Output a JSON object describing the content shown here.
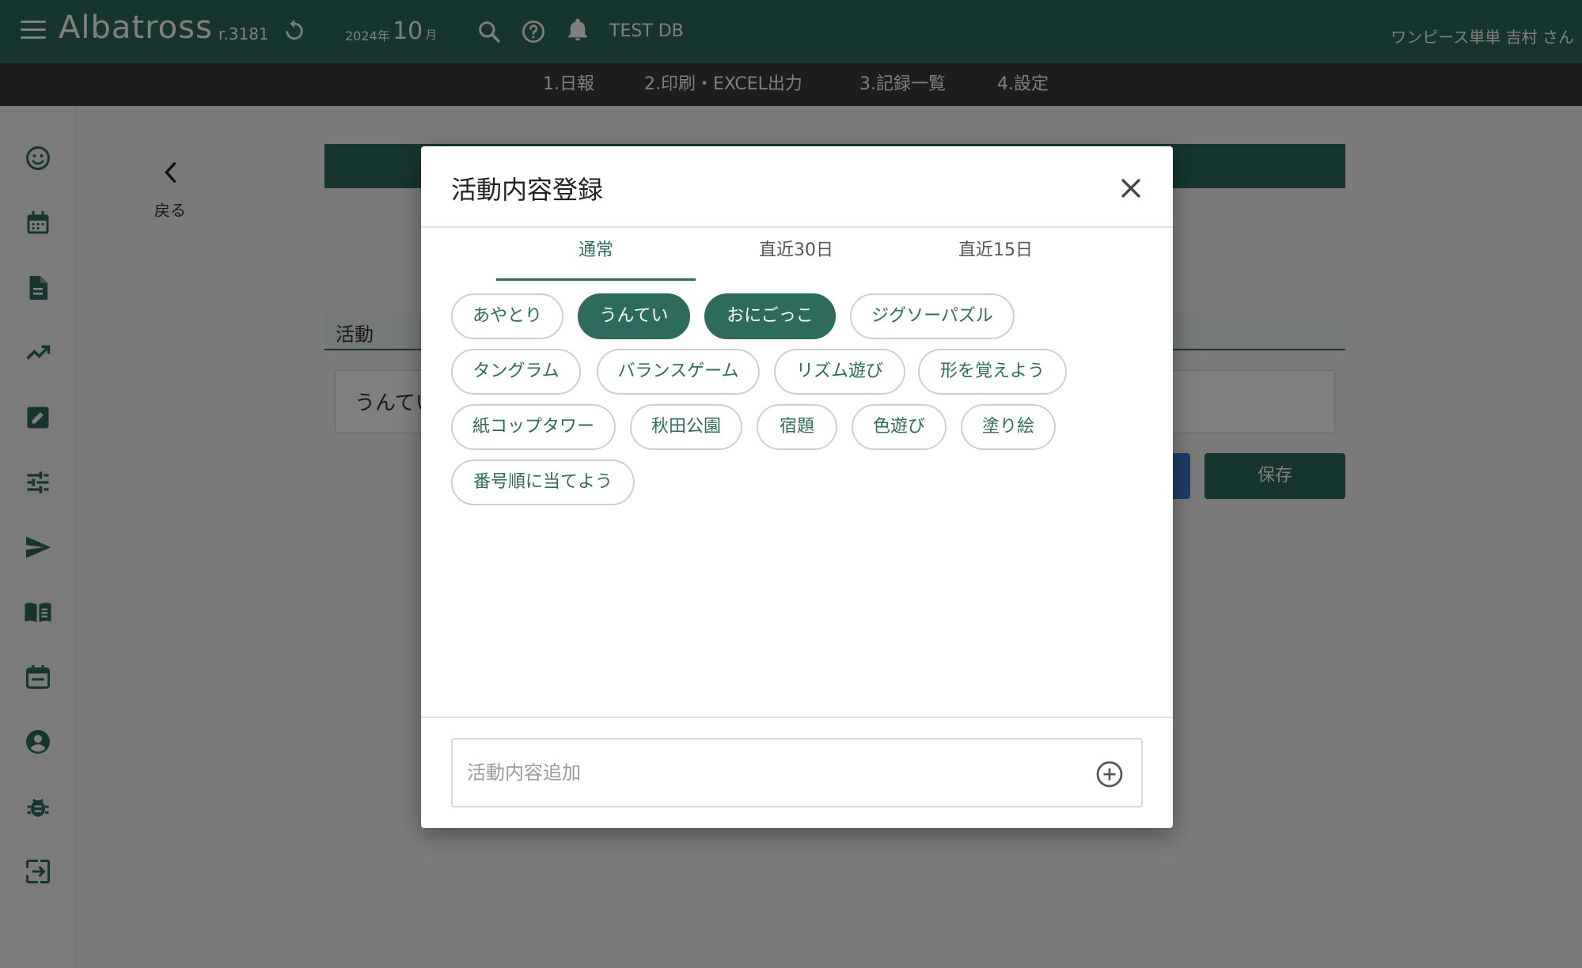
{
  "header": {
    "app_title": "Albatross",
    "revision": "r.3181",
    "year": "2024年",
    "month": "10",
    "month_unit": "月",
    "db_label": "TEST DB",
    "user": "ワンピース単単 吉村 さん",
    "icons": [
      "menu-icon",
      "refresh-icon",
      "search-icon",
      "help-icon",
      "bell-icon"
    ]
  },
  "subnav": {
    "items": [
      "1.日報",
      "2.印刷・EXCEL出力",
      "3.記録一覧",
      "4.設定"
    ]
  },
  "sidebar": {
    "icons": [
      "smiley-icon",
      "calendar-icon",
      "document-icon",
      "trending-icon",
      "edit-icon",
      "tune-icon",
      "send-icon",
      "book-icon",
      "event-icon",
      "account-icon",
      "bug-icon",
      "logout-icon"
    ]
  },
  "page": {
    "back_label": "戻る",
    "section_title": "活動",
    "activity_value": "うんてい",
    "save_label": "保存"
  },
  "modal": {
    "title": "活動内容登録",
    "tabs": [
      {
        "label": "通常",
        "active": true
      },
      {
        "label": "直近30日",
        "active": false
      },
      {
        "label": "直近15日",
        "active": false
      }
    ],
    "chips": [
      {
        "label": "あやとり",
        "selected": false
      },
      {
        "label": "うんてい",
        "selected": true
      },
      {
        "label": "おにごっこ",
        "selected": true
      },
      {
        "label": "ジグソーパズル",
        "selected": false
      },
      {
        "label": "タングラム",
        "selected": false
      },
      {
        "label": "バランスゲーム",
        "selected": false
      },
      {
        "label": "リズム遊び",
        "selected": false
      },
      {
        "label": "形を覚えよう",
        "selected": false
      },
      {
        "label": "紙コップタワー",
        "selected": false
      },
      {
        "label": "秋田公園",
        "selected": false
      },
      {
        "label": "宿題",
        "selected": false
      },
      {
        "label": "色遊び",
        "selected": false
      },
      {
        "label": "塗り絵",
        "selected": false
      },
      {
        "label": "番号順に当てよう",
        "selected": false
      }
    ],
    "add_placeholder": "活動内容追加"
  },
  "colors": {
    "brand": "#2d6b5c",
    "subnav": "#373b3d",
    "accent_blue": "#3a78c9"
  }
}
